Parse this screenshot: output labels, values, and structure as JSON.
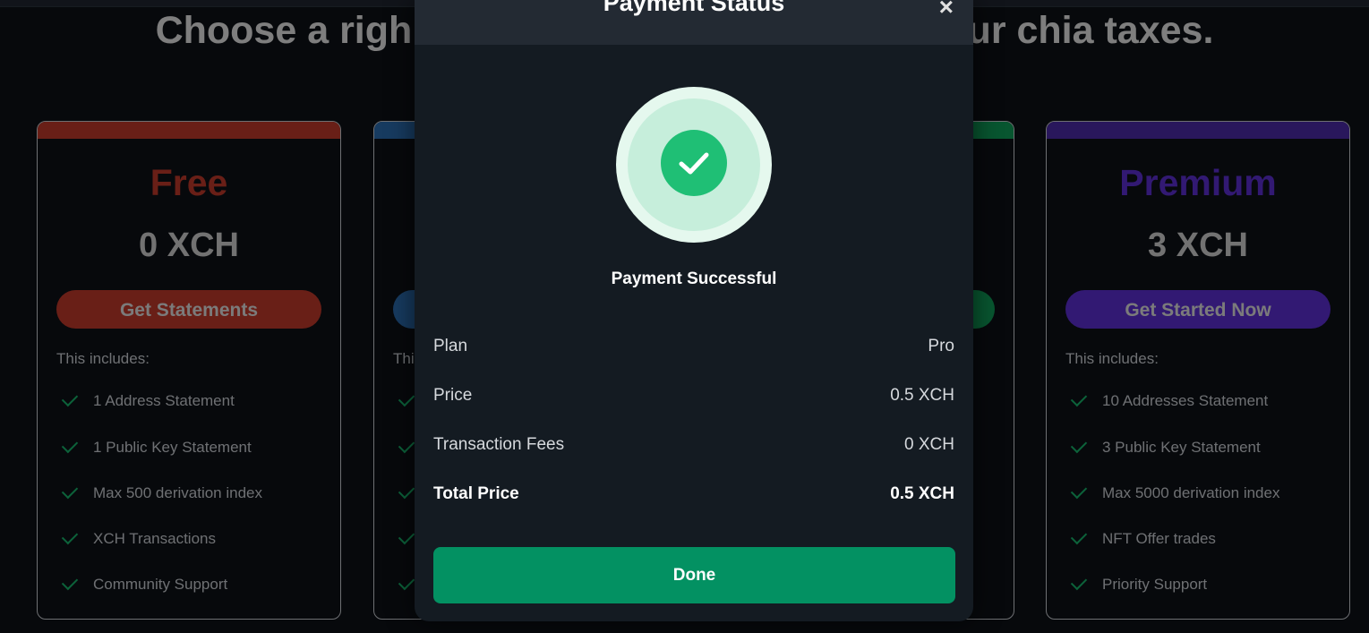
{
  "page": {
    "headline_left": "Choose a righ",
    "headline_right": "our chia taxes."
  },
  "plans": {
    "free": {
      "name": "Free",
      "price": "0 XCH",
      "cta": "Get Statements",
      "includes": "This includes:",
      "features": [
        "1 Address Statement",
        "1 Public Key Statement",
        "Max 500 derivation index",
        "XCH Transactions",
        "Community Support"
      ]
    },
    "pro": {
      "includes": "Thi"
    },
    "premium": {
      "name": "Premium",
      "price": "3 XCH",
      "cta": "Get Started Now",
      "includes": "This includes:",
      "features": [
        "10 Addresses Statement",
        "3 Public Key Statement",
        "Max 5000 derivation index",
        "NFT Offer trades",
        "Priority Support"
      ]
    }
  },
  "modal": {
    "title": "Payment Status",
    "status": "Payment Successful",
    "rows": [
      {
        "label": "Plan",
        "value": "Pro"
      },
      {
        "label": "Price",
        "value": "0.5 XCH"
      },
      {
        "label": "Transaction Fees",
        "value": "0 XCH"
      },
      {
        "label": "Total Price",
        "value": "0.5 XCH"
      }
    ],
    "done_label": "Done",
    "close_glyph": "×"
  },
  "colors": {
    "free": "#c0392b",
    "pro": "#2b6cb0",
    "business": "#0f9d58",
    "premium": "#5b2fd1",
    "success": "#1fbf75",
    "done_button": "#039162"
  }
}
